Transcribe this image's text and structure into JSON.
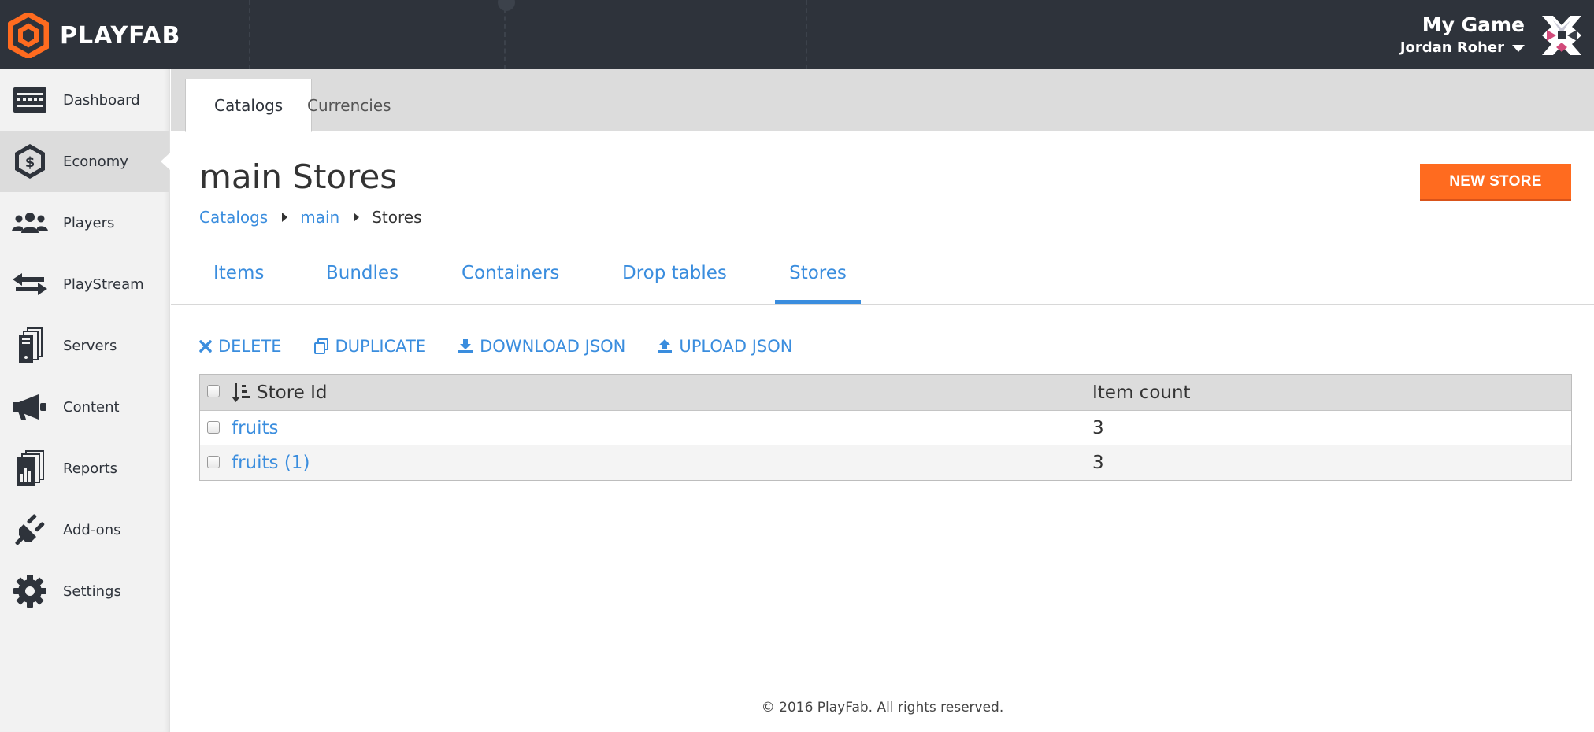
{
  "brand": {
    "name": "PLAYFAB",
    "accent": "#ff6b1f",
    "link": "#3a8dde",
    "topbar_bg": "#2e333b"
  },
  "header": {
    "game_name": "My Game",
    "user_name": "Jordan Roher"
  },
  "sidebar": {
    "items": [
      {
        "label": "Dashboard",
        "icon": "dashboard-icon"
      },
      {
        "label": "Economy",
        "icon": "economy-icon",
        "active": true
      },
      {
        "label": "Players",
        "icon": "players-icon"
      },
      {
        "label": "PlayStream",
        "icon": "playstream-icon"
      },
      {
        "label": "Servers",
        "icon": "servers-icon"
      },
      {
        "label": "Content",
        "icon": "megaphone-icon"
      },
      {
        "label": "Reports",
        "icon": "reports-icon"
      },
      {
        "label": "Add-ons",
        "icon": "plug-icon"
      },
      {
        "label": "Settings",
        "icon": "gear-icon"
      }
    ]
  },
  "catalog_tabs": [
    {
      "label": "Catalogs",
      "active": true
    },
    {
      "label": "Currencies"
    }
  ],
  "page": {
    "title": "main Stores",
    "new_button": "NEW STORE",
    "breadcrumb": [
      "Catalogs",
      "main",
      "Stores"
    ]
  },
  "sub_tabs": [
    {
      "label": "Items"
    },
    {
      "label": "Bundles"
    },
    {
      "label": "Containers"
    },
    {
      "label": "Drop tables"
    },
    {
      "label": "Stores",
      "active": true
    }
  ],
  "actions": [
    "DELETE",
    "DUPLICATE",
    "DOWNLOAD JSON",
    "UPLOAD JSON"
  ],
  "table": {
    "columns": [
      "Store Id",
      "Item count"
    ],
    "rows": [
      {
        "id": "fruits",
        "count": "3"
      },
      {
        "id": "fruits (1)",
        "count": "3"
      }
    ]
  },
  "footer": "© 2016 PlayFab. All rights reserved."
}
